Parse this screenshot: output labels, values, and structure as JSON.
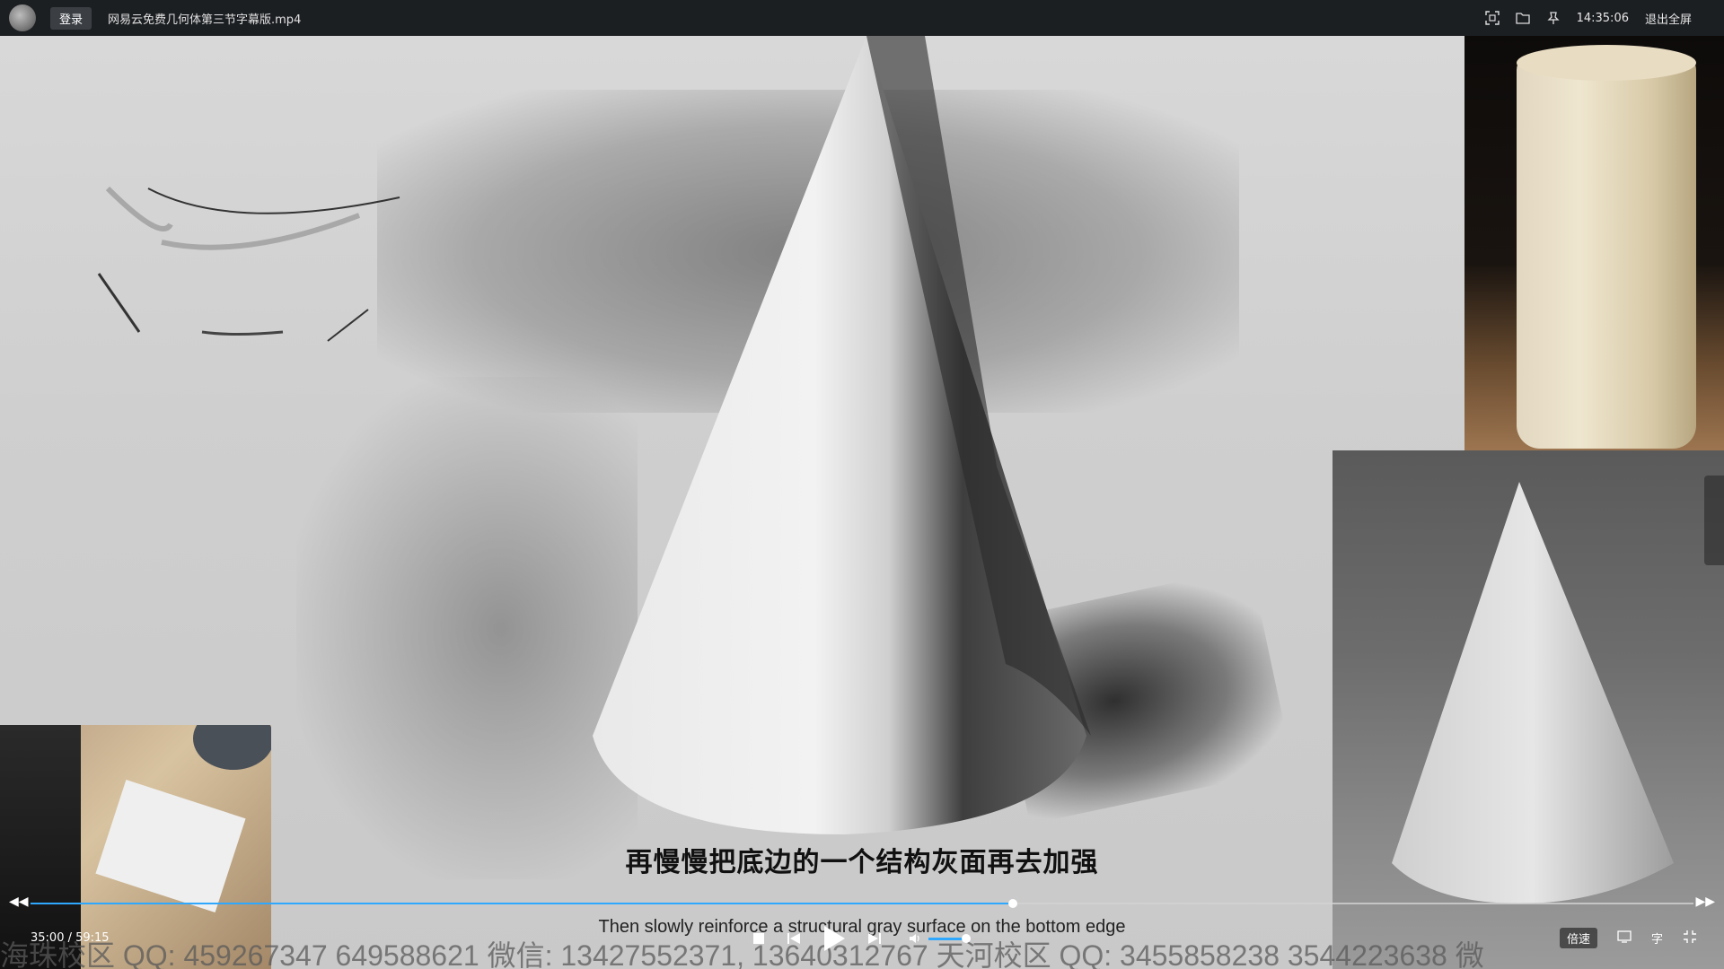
{
  "titlebar": {
    "login_label": "登录",
    "filename": "网易云免费几何体第三节字幕版.mp4",
    "clock": "14:35:06",
    "exit_fullscreen": "退出全屏",
    "icons": [
      "screenshot-icon",
      "folder-icon",
      "pin-icon"
    ]
  },
  "subtitles": {
    "chinese": "再慢慢把底边的一个结构灰面再去加强",
    "english": "Then slowly reinforce a structural gray surface on the bottom edge"
  },
  "watermark": "海珠校区 QQ: 459267347 649588621 微信: 13427552371, 13640312767 天河校区 QQ: 3455858238 3544223638 微",
  "player": {
    "time_display": "35:00 / 59:15",
    "progress_fraction": 0.5906,
    "volume_fraction": 0.7,
    "speed_label": "倍速",
    "subtitle_toggle": "字",
    "colors": {
      "accent": "#2ea8ff",
      "titlebar": "#1c1f22"
    }
  }
}
